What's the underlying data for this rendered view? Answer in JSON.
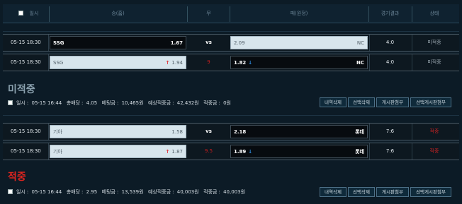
{
  "header": {
    "time_label": "일시",
    "home_label": "승(홈)",
    "mid_label": "무",
    "away_label": "패(원정)",
    "result_label": "경기결과",
    "status_label": "상태"
  },
  "slip1": {
    "rows": [
      {
        "time": "05-15 18:30",
        "home": "SSG",
        "home_odds": "1.67",
        "home_selected": true,
        "home_arrow": "",
        "mid": "vs",
        "away": "NC",
        "away_odds": "2.09",
        "away_selected": false,
        "away_arrow": "",
        "score": "4:0",
        "status": "미적중"
      },
      {
        "time": "05-15 18:30",
        "home": "SSG",
        "home_odds": "1.94",
        "home_selected": false,
        "home_arrow": "↑",
        "mid": "9",
        "away": "NC",
        "away_odds": "1.82",
        "away_selected": true,
        "away_arrow": "↓",
        "score": "4:0",
        "status": "미적중"
      }
    ]
  },
  "section1": {
    "title": "미적중",
    "date_label": "일시",
    "date": "05-15 16:44",
    "odds_label": "총배당",
    "odds": "4.05",
    "stake_label": "베팅금",
    "stake": "10,465원",
    "expected_label": "예상적중금",
    "expected": "42,432원",
    "payout_label": "적중금",
    "payout": "0원"
  },
  "slip2": {
    "rows": [
      {
        "time": "05-15 18:30",
        "home": "기아",
        "home_odds": "1.58",
        "home_selected": false,
        "home_arrow": "",
        "mid": "vs",
        "away": "롯데",
        "away_odds": "2.18",
        "away_selected": true,
        "away_arrow": "",
        "score": "7:6",
        "status": "적중"
      },
      {
        "time": "05-15 18:30",
        "home": "기아",
        "home_odds": "1.87",
        "home_selected": false,
        "home_arrow": "↑",
        "mid": "9.5",
        "away": "롯데",
        "away_odds": "1.89",
        "away_selected": true,
        "away_arrow": "↓",
        "score": "7:6",
        "status": "적중"
      }
    ]
  },
  "section2": {
    "title": "적중",
    "date_label": "일시",
    "date": "05-15 16:44",
    "odds_label": "총배당",
    "odds": "2.95",
    "stake_label": "베팅금",
    "stake": "13,539원",
    "expected_label": "예상적중금",
    "expected": "40,003원",
    "payout_label": "적중금",
    "payout": "40,003원"
  },
  "buttons": {
    "delete_history": "내역삭제",
    "delete_selected": "선택삭제",
    "attach_board": "게시판첨부",
    "attach_selected_board": "선택게시판첨부"
  },
  "colors": {
    "background": "#0c1b26",
    "selected_bet_bg": "#070b0f",
    "unselected_bet_bg": "#d7e5ec",
    "hit": "#e0251f",
    "arrow_up": "#e0262b",
    "arrow_down": "#2f8fe6"
  }
}
